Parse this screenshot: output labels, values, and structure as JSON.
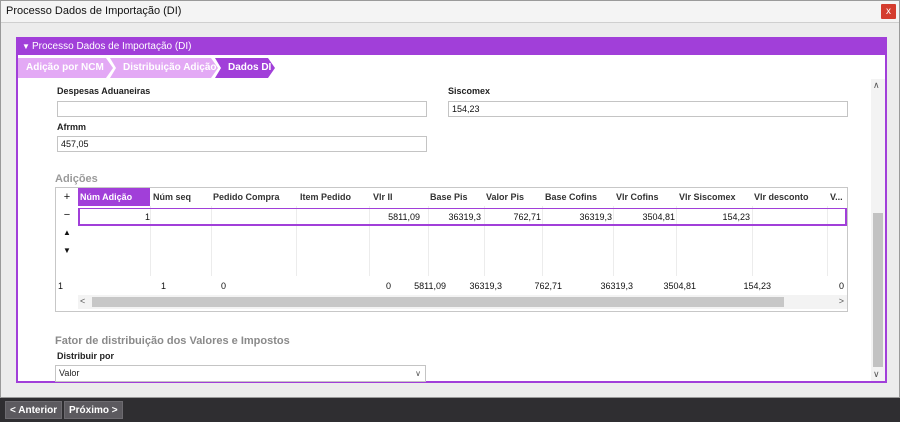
{
  "window": {
    "title": "Processo Dados de Importação (DI)",
    "close_label": "x"
  },
  "panel": {
    "header": "Processo Dados de Importação (DI)"
  },
  "steps": [
    "Adição por NCM",
    "Distribuição Adição",
    "Dados DI"
  ],
  "form": {
    "despesas_label": "Despesas Aduaneiras",
    "despesas_value": "",
    "siscomex_label": "Siscomex",
    "siscomex_value": "154,23",
    "afrmm_label": "Afrmm",
    "afrmm_value": "457,05"
  },
  "adicoes": {
    "title": "Adições",
    "side_buttons": [
      "+",
      "−",
      "▲",
      "▼"
    ],
    "columns": [
      "Núm Adição",
      "Núm seq",
      "Pedido Compra",
      "Item Pedido",
      "Vlr II",
      "Base Pis",
      "Valor Pis",
      "Base Cofins",
      "Vlr Cofins",
      "Vlr Siscomex",
      "Vlr desconto",
      "V..."
    ],
    "row": [
      "1",
      "",
      "",
      "",
      "5811,09",
      "36319,3",
      "762,71",
      "36319,3",
      "3504,81",
      "154,23",
      "",
      ""
    ],
    "totals": {
      "count": "1",
      "values": [
        "1",
        "0",
        "",
        "0",
        "5811,09",
        "36319,3",
        "762,71",
        "36319,3",
        "3504,81",
        "154,23",
        "0"
      ]
    }
  },
  "fator": {
    "title": "Fator de distribuição dos Valores e Impostos",
    "distribuir_label": "Distribuir por",
    "distribuir_value": "Valor"
  },
  "footer": {
    "prev": "< Anterior",
    "next": "Próximo >"
  },
  "colors": {
    "accent": "#a13fd9",
    "accent_light": "#e3a9f5"
  }
}
